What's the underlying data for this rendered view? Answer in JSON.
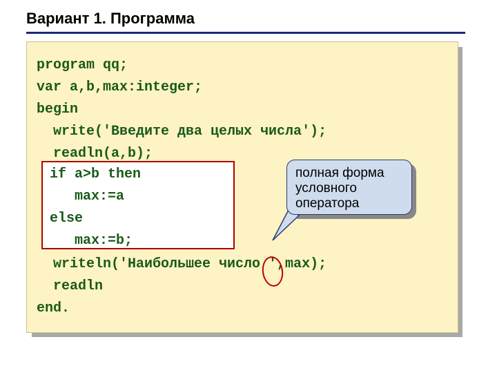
{
  "title": "Вариант 1. Программа",
  "code": {
    "line1": "program qq;",
    "line2": "var a,b,max:integer;",
    "line3": "begin",
    "line4": "  write('Введите два целых числа');",
    "line5": "  readln(a,b);",
    "line6_blank": " ",
    "line7_blank": " ",
    "line8_blank": " ",
    "line9_blank": " ",
    "line10": "  writeln('Наибольшее число ',max);",
    "line11": "  readln",
    "line12": "end."
  },
  "highlight": {
    "h1": "if a>b then",
    "h2": "   max:=a",
    "h3": "else",
    "h4": "   max:=b;"
  },
  "callout": "полная форма условного оператора"
}
